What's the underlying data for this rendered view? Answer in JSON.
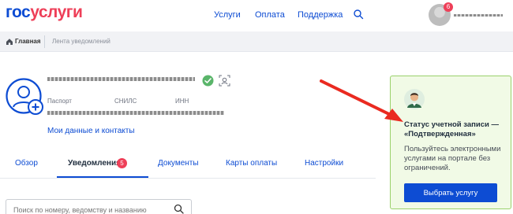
{
  "header": {
    "logo_part1": "гос",
    "logo_part2": "услуги",
    "nav": [
      "Услуги",
      "Оплата",
      "Поддержка"
    ],
    "notifications_count": "6"
  },
  "breadcrumbs": {
    "home": "Главная",
    "current": "Лента уведомлений"
  },
  "profile": {
    "doc_labels": [
      "Паспорт",
      "СНИЛС",
      "ИНН"
    ],
    "my_data_link": "Мои данные и контакты"
  },
  "tabs": {
    "items": [
      "Обзор",
      "Уведомления",
      "Документы",
      "Карты оплаты",
      "Настройки"
    ],
    "active": "Уведомления",
    "badge": "5"
  },
  "search": {
    "placeholder": "Поиск по номеру, ведомству и названию"
  },
  "status_card": {
    "title": "Статус учетной записи — «Подтвержденная»",
    "description": "Пользуйтесь электронными услугами на портале без ограничений.",
    "button": "Выбрать услугу"
  },
  "colors": {
    "brand_blue": "#0d4cd3",
    "brand_red": "#ee3f58",
    "card_green": "#f1fae6",
    "ok_green": "#5ab56a",
    "arrow_red": "#ea2a20"
  }
}
